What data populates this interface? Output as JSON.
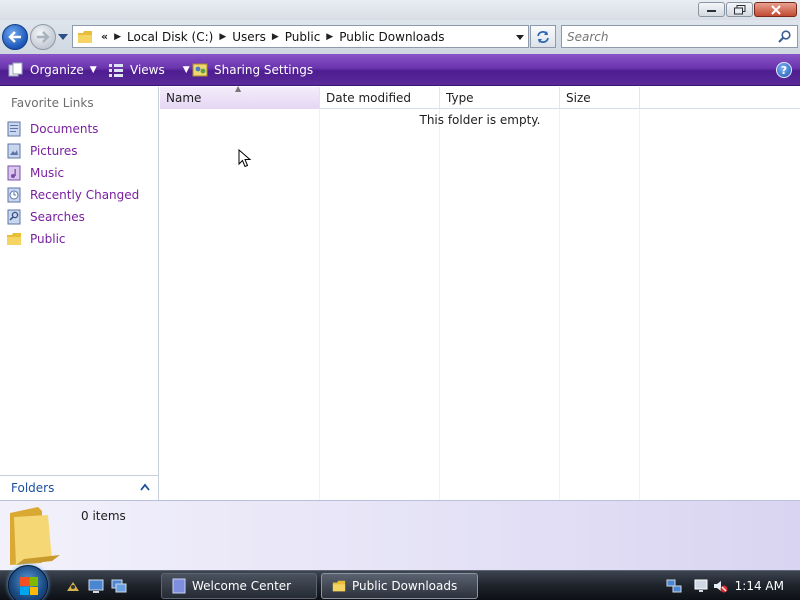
{
  "window": {
    "controls": [
      "minimize",
      "maximize",
      "close"
    ]
  },
  "address": {
    "overflow_chevron": "«",
    "crumbs": [
      "Local Disk (C:)",
      "Users",
      "Public",
      "Public Downloads"
    ],
    "search_placeholder": "Search"
  },
  "commands": {
    "organize": "Organize",
    "views": "Views",
    "sharing": "Sharing Settings",
    "help": "?"
  },
  "nav": {
    "favorites_title": "Favorite Links",
    "items": [
      {
        "label": "Documents",
        "icon": "documents-icon"
      },
      {
        "label": "Pictures",
        "icon": "pictures-icon"
      },
      {
        "label": "Music",
        "icon": "music-icon"
      },
      {
        "label": "Recently Changed",
        "icon": "recently-changed-icon"
      },
      {
        "label": "Searches",
        "icon": "searches-icon"
      },
      {
        "label": "Public",
        "icon": "folder-icon"
      }
    ],
    "folders_label": "Folders"
  },
  "list": {
    "columns": [
      "Name",
      "Date modified",
      "Type",
      "Size"
    ],
    "sorted_column": "Name",
    "empty_message": "This folder is empty."
  },
  "details": {
    "item_count": "0 items"
  },
  "taskbar": {
    "buttons": [
      "Welcome Center",
      "Public Downloads"
    ],
    "active": "Public Downloads",
    "clock": "1:14 AM"
  },
  "colors": {
    "command_bar": "#6a34ad",
    "link": "#7a1fa0",
    "taskbar": "#1e232b",
    "accent_blue": "#1b56b8"
  }
}
